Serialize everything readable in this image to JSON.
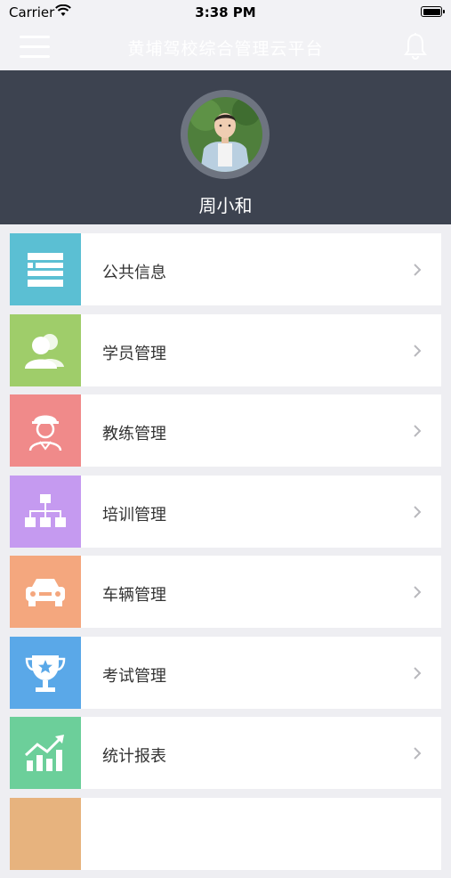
{
  "status_bar": {
    "carrier": "Carrier",
    "time": "3:38 PM"
  },
  "nav": {
    "title": "黄埔驾校综合管理云平台"
  },
  "profile": {
    "name": "周小和"
  },
  "menu": {
    "items": [
      {
        "label": "公共信息",
        "color": "#5bbfd3",
        "icon": "public-info-icon"
      },
      {
        "label": "学员管理",
        "color": "#9fcd6a",
        "icon": "students-icon"
      },
      {
        "label": "教练管理",
        "color": "#f08a8a",
        "icon": "coach-icon"
      },
      {
        "label": "培训管理",
        "color": "#c59af0",
        "icon": "training-hierarchy-icon"
      },
      {
        "label": "车辆管理",
        "color": "#f4a77e",
        "icon": "car-icon"
      },
      {
        "label": "考试管理",
        "color": "#5aa8e8",
        "icon": "trophy-icon"
      },
      {
        "label": "统计报表",
        "color": "#6ccf9a",
        "icon": "bar-chart-icon"
      },
      {
        "label": "",
        "color": "#e7b37e",
        "icon": "partial-item-icon"
      }
    ]
  }
}
